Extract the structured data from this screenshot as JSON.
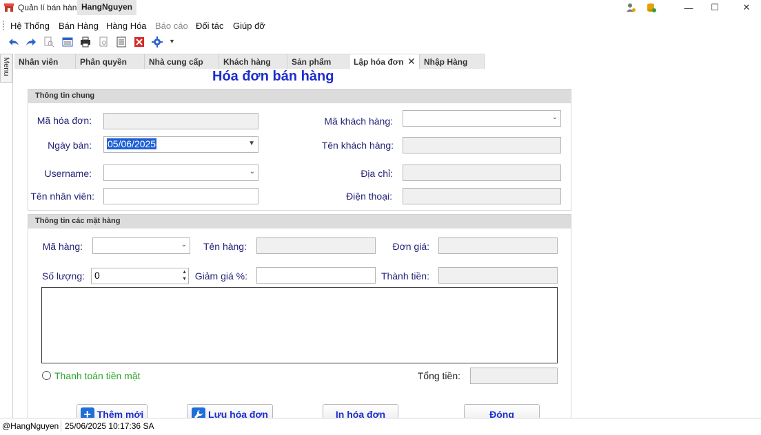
{
  "window": {
    "app_title": "Quản lí bán hàng",
    "user_title": "HangNguyen",
    "minimize": "—",
    "maximize": "☐",
    "close": "✕"
  },
  "menu": [
    "Hệ Thống",
    "Bán Hàng",
    "Hàng Hóa",
    "Báo cáo",
    "Đối tác",
    "Giúp đỡ"
  ],
  "left_panel": {
    "label": "Menu"
  },
  "tabs": [
    {
      "label": "Nhân viên"
    },
    {
      "label": "Phân quyền"
    },
    {
      "label": "Nhà cung cấp"
    },
    {
      "label": "Khách hàng"
    },
    {
      "label": "Sản phẩm"
    },
    {
      "label": "Lập hóa đơn"
    },
    {
      "label": "Nhập Hàng"
    }
  ],
  "tab_close": "✕",
  "form": {
    "title": "Hóa đơn bán hàng",
    "general": {
      "header": "Thông tin chung",
      "invoice_id_label": "Mã hóa đơn:",
      "invoice_id_value": "",
      "sale_date_label": "Ngày bán:",
      "sale_date_value": "05/06/2025",
      "username_label": "Username:",
      "username_value": "",
      "staff_name_label": "Tên nhân viên:",
      "staff_name_value": "",
      "customer_id_label": "Mã khách hàng:",
      "customer_id_value": "",
      "customer_name_label": "Tên khách hàng:",
      "customer_name_value": "",
      "address_label": "Địa chỉ:",
      "address_value": "",
      "phone_label": "Điện thoại:",
      "phone_value": ""
    },
    "items": {
      "header": "Thông tin các mặt hàng",
      "item_id_label": "Mã hàng:",
      "item_name_label": "Tên hàng:",
      "unit_price_label": "Đơn giá:",
      "quantity_label": "Số lượng:",
      "quantity_value": "0",
      "discount_label": "Giảm giá %:",
      "line_total_label": "Thành tiền:"
    },
    "cash_payment_label": "Thanh toán tiền mặt",
    "total_label": "Tổng tiền:",
    "total_value": "",
    "buttons": {
      "add": "Thêm mới",
      "save": "Lưu hóa đơn",
      "print": "In hóa đơn",
      "close": "Đóng"
    }
  },
  "status": {
    "user": "@HangNguyen",
    "datetime": "25/06/2025 10:17:36 SA"
  }
}
